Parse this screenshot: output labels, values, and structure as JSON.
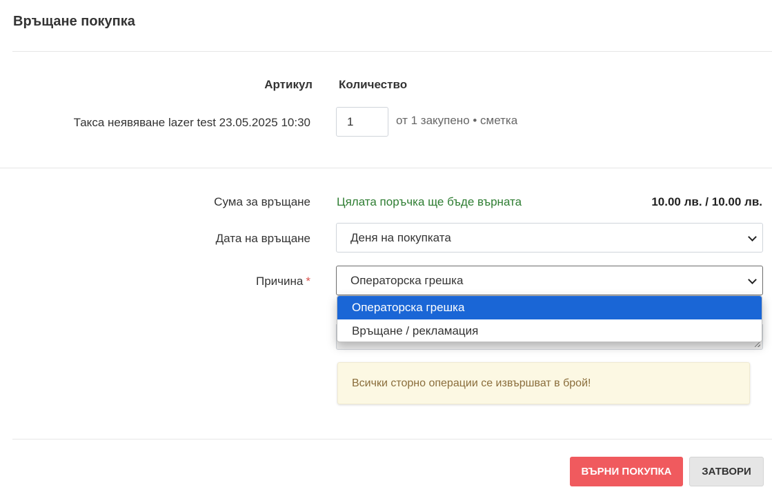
{
  "modal": {
    "title": "Връщане покупка"
  },
  "items_table": {
    "headers": {
      "article": "Артикул",
      "quantity": "Количество"
    },
    "rows": [
      {
        "article": "Такса неявяване lazer test 23.05.2025 10:30",
        "quantity": "1",
        "note": "от 1 закупено • сметка"
      }
    ]
  },
  "refund": {
    "amount_label": "Сума за връщане",
    "info": "Цялата поръчка ще бъде върната",
    "amount": "10.00 лв. / 10.00 лв."
  },
  "return_date": {
    "label": "Дата на връщане",
    "selected": "Деня на покупката"
  },
  "reason": {
    "label": "Причина",
    "required_mark": "*",
    "selected": "Операторска грешка",
    "options": [
      "Операторска грешка",
      "Връщане / рекламация"
    ]
  },
  "alert": {
    "text": "Всички сторно операции се извършват в брой!"
  },
  "footer": {
    "return_button": "ВЪРНИ ПОКУПКА",
    "close_button": "ЗАТВОРИ"
  },
  "colors": {
    "primary_button": "#f05a5e",
    "dropdown_highlight": "#1a66d6",
    "info_text": "#2e7d32",
    "alert_bg": "#fcf8e3",
    "alert_text": "#8a6d3b"
  },
  "icons": {
    "select_chevron": "chevron-down-icon",
    "textarea_resize": "resize-grip-icon"
  }
}
